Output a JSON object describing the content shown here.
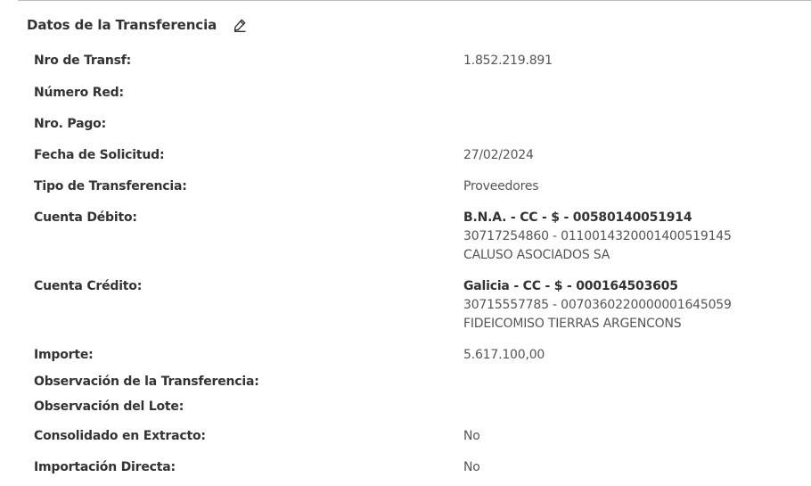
{
  "section": {
    "title": "Datos de la Transferencia",
    "edit_icon": "pencil-edit-icon"
  },
  "fields": {
    "nro_transf": {
      "label": "Nro de Transf:",
      "value": "1.852.219.891"
    },
    "numero_red": {
      "label": "Número Red:",
      "value": ""
    },
    "nro_pago": {
      "label": "Nro. Pago:",
      "value": ""
    },
    "fecha_solicitud": {
      "label": "Fecha de Solicitud:",
      "value": "27/02/2024"
    },
    "tipo_transferencia": {
      "label": "Tipo de Transferencia:",
      "value": "Proveedores"
    },
    "cuenta_debito": {
      "label": "Cuenta Débito:",
      "line1": "B.N.A. - CC - $ - 00580140051914",
      "line2": "30717254860 - 0110014320001400519145",
      "line3": "CALUSO ASOCIADOS SA"
    },
    "cuenta_credito": {
      "label": "Cuenta Crédito:",
      "line1": "Galicia - CC - $ - 000164503605",
      "line2": "30715557785 - 0070360220000001645059",
      "line3": "FIDEICOMISO TIERRAS ARGENCONS"
    },
    "importe": {
      "label": "Importe:",
      "value": "5.617.100,00"
    },
    "observacion_transferencia": {
      "label": "Observación de la Transferencia:",
      "value": ""
    },
    "observacion_lote": {
      "label": "Observación del Lote:",
      "value": ""
    },
    "consolidado_extracto": {
      "label": "Consolidado en Extracto:",
      "value": "No"
    },
    "importacion_directa": {
      "label": "Importación Directa:",
      "value": "No"
    }
  }
}
